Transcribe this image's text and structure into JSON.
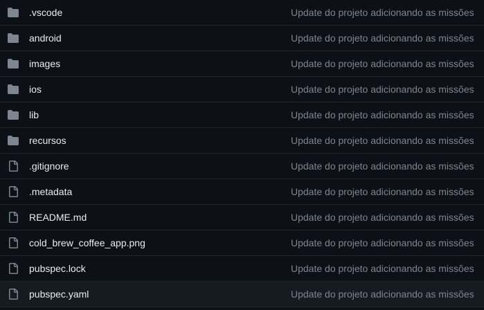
{
  "colors": {
    "background": "#0d1117",
    "row_hover": "#161b22",
    "divider": "#21262d",
    "name_text": "#e6edf3",
    "commit_text": "#7d8590",
    "icon": "#7d8590"
  },
  "files": [
    {
      "name": ".vscode",
      "type": "folder",
      "icon": "folder-icon",
      "commit_message": "Update do projeto adicionando as missões"
    },
    {
      "name": "android",
      "type": "folder",
      "icon": "folder-icon",
      "commit_message": "Update do projeto adicionando as missões"
    },
    {
      "name": "images",
      "type": "folder",
      "icon": "folder-icon",
      "commit_message": "Update do projeto adicionando as missões"
    },
    {
      "name": "ios",
      "type": "folder",
      "icon": "folder-icon",
      "commit_message": "Update do projeto adicionando as missões"
    },
    {
      "name": "lib",
      "type": "folder",
      "icon": "folder-icon",
      "commit_message": "Update do projeto adicionando as missões"
    },
    {
      "name": "recursos",
      "type": "folder",
      "icon": "folder-icon",
      "commit_message": "Update do projeto adicionando as missões"
    },
    {
      "name": ".gitignore",
      "type": "file",
      "icon": "file-icon",
      "commit_message": "Update do projeto adicionando as missões"
    },
    {
      "name": ".metadata",
      "type": "file",
      "icon": "file-icon",
      "commit_message": "Update do projeto adicionando as missões"
    },
    {
      "name": "README.md",
      "type": "file",
      "icon": "file-icon",
      "commit_message": "Update do projeto adicionando as missões"
    },
    {
      "name": "cold_brew_coffee_app.png",
      "type": "file",
      "icon": "file-icon",
      "commit_message": "Update do projeto adicionando as missões"
    },
    {
      "name": "pubspec.lock",
      "type": "file",
      "icon": "file-icon",
      "commit_message": "Update do projeto adicionando as missões"
    },
    {
      "name": "pubspec.yaml",
      "type": "file",
      "icon": "file-icon",
      "commit_message": "Update do projeto adicionando as missões",
      "highlighted": true
    }
  ]
}
